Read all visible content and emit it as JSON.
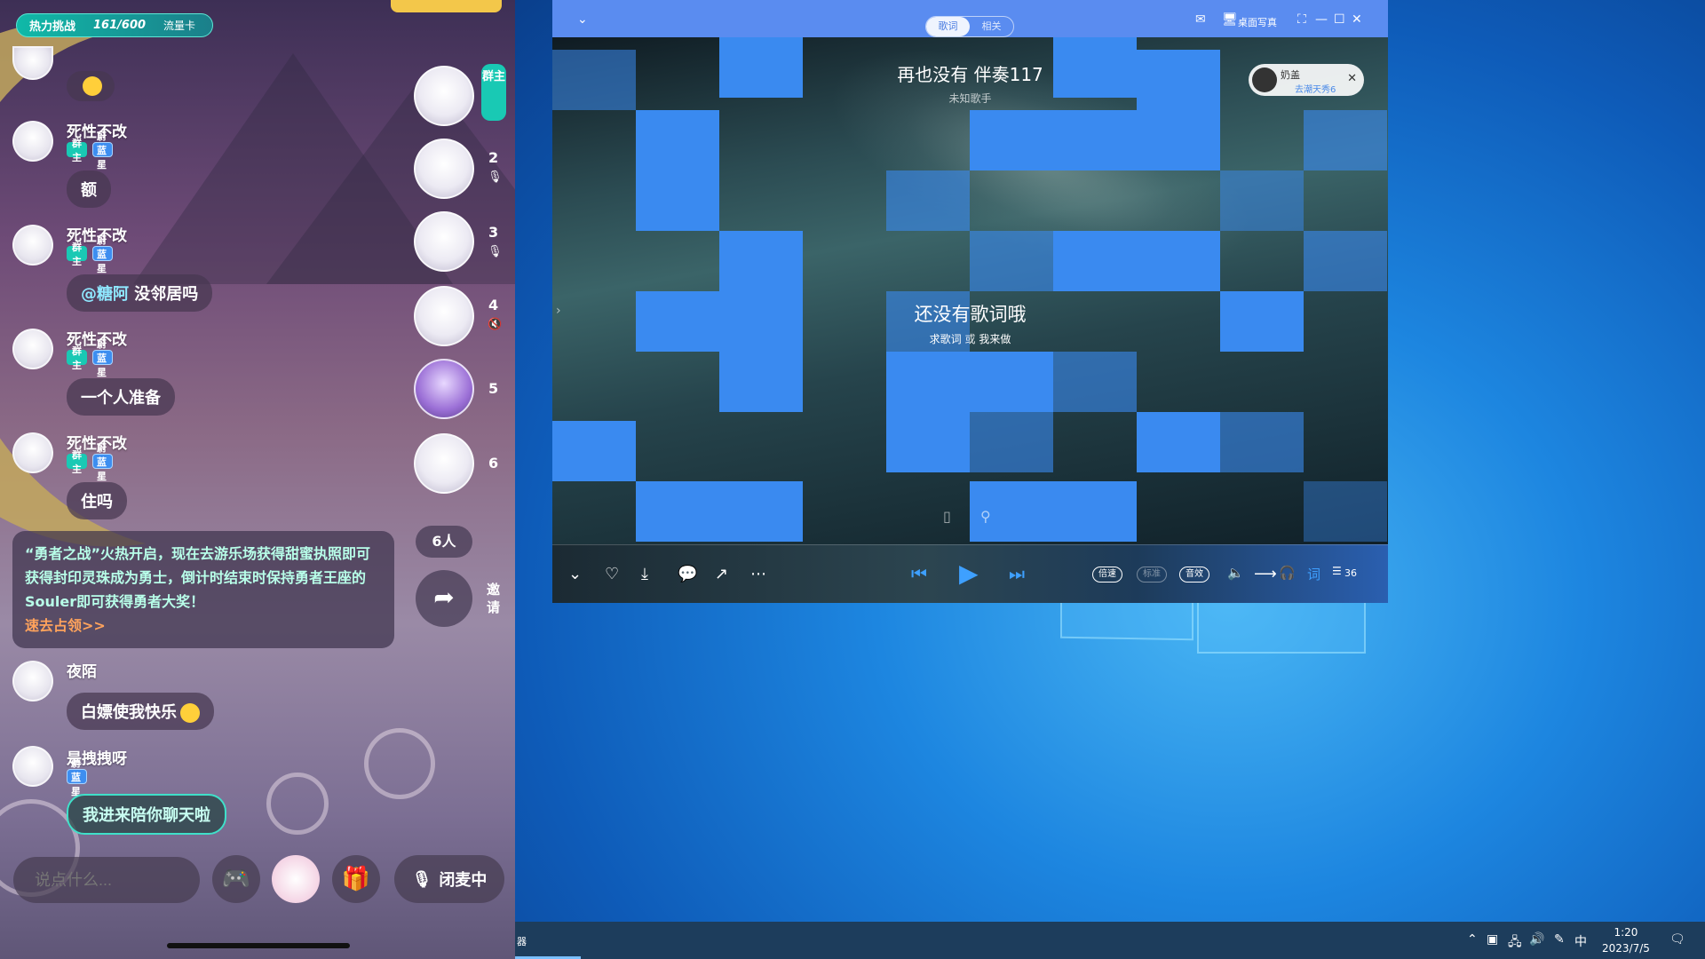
{
  "phone": {
    "top_pill": {
      "label": "热力挑战",
      "count": "161/600",
      "card": "流量卡"
    },
    "messages": [
      {
        "user": "死性不改",
        "badges": [
          "群主",
          "蔚蓝星"
        ],
        "text": "额"
      },
      {
        "user": "死性不改",
        "badges": [
          "群主",
          "蔚蓝星"
        ],
        "mention": "@糖阿",
        "text": " 没邻居吗"
      },
      {
        "user": "死性不改",
        "badges": [
          "群主",
          "蔚蓝星"
        ],
        "text": "一个人准备"
      },
      {
        "user": "死性不改",
        "badges": [
          "群主",
          "蔚蓝星"
        ],
        "text": "住吗"
      },
      {
        "user": "夜陌",
        "badges": [],
        "text": "白嫖使我快乐"
      },
      {
        "user": "是拽拽呀",
        "badges": [
          "蔚蓝星"
        ],
        "text": "我进来陪你聊天啦"
      }
    ],
    "system_notice": {
      "text": "“勇者之战”火热开启，现在去游乐场获得甜蜜执照即可获得封印灵珠成为勇士，倒计时结束时保持勇者王座的Souler即可获得勇者大奖！",
      "link": "速去占领>>"
    },
    "host_tag": "群主",
    "seats": [
      "2",
      "3",
      "4",
      "5",
      "6"
    ],
    "people_count": "6人",
    "invite_label": "邀请",
    "input_placeholder": "说点什么...",
    "mic_status": "闭麦中",
    "icons": [
      "gamepad-icon",
      "gift-icon",
      "mic-off-icon",
      "share-icon"
    ]
  },
  "player": {
    "tabs": [
      "歌词",
      "相关"
    ],
    "active_tab": "歌词",
    "desktop_lyrics_label": "桌面写真",
    "song_title": "再也没有 伴奏117",
    "singer": "未知歌手",
    "no_lyrics": "还没有歌词哦",
    "lyric_request": "求歌词",
    "lyric_or": " 或 ",
    "lyric_make": "我来做",
    "user_chip": {
      "name": "奶盖",
      "sub": "去潮天秀6"
    },
    "controls": {
      "speed_label": "倍速",
      "quality_label": "标准",
      "effect_label": "音效",
      "lyrics_label": "词",
      "playlist_count": "36"
    }
  },
  "taskbar": {
    "left_label": "器",
    "ime": "中",
    "time": "1:20",
    "date": "2023/7/5"
  },
  "colors": {
    "accent_teal": "#19c9b4",
    "accent_blue": "#3ea0ff",
    "player_bg": "#5a8cf0",
    "taskbar": "#1d3d5c"
  }
}
